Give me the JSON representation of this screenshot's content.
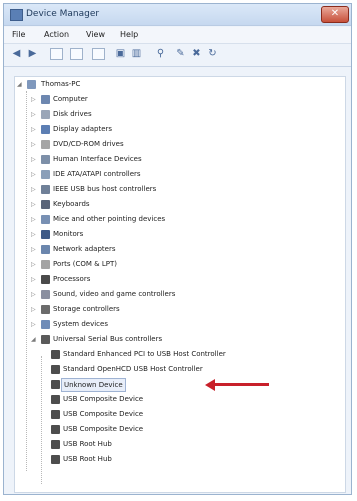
{
  "window": {
    "title": "Device Manager",
    "close_glyph": "✕"
  },
  "menu": [
    "File",
    "Action",
    "View",
    "Help"
  ],
  "tree": {
    "root": "Thomas-PC",
    "categories": [
      "Computer",
      "Disk drives",
      "Display adapters",
      "DVD/CD-ROM drives",
      "Human Interface Devices",
      "IDE ATA/ATAPI controllers",
      "IEEE USB bus host controllers",
      "Keyboards",
      "Mice and other pointing devices",
      "Monitors",
      "Network adapters",
      "Ports (COM & LPT)",
      "Processors",
      "Sound, video and game controllers",
      "Storage controllers",
      "System devices",
      "Universal Serial Bus controllers"
    ],
    "usb_children": [
      "Standard Enhanced PCI to USB Host Controller",
      "Standard OpenHCD USB Host Controller",
      "Unknown Device",
      "USB Composite Device",
      "USB Composite Device",
      "USB Composite Device",
      "USB Root Hub",
      "USB Root Hub"
    ]
  },
  "colors": {
    "accent": "#c8202a",
    "selection": "#e8eef9"
  }
}
